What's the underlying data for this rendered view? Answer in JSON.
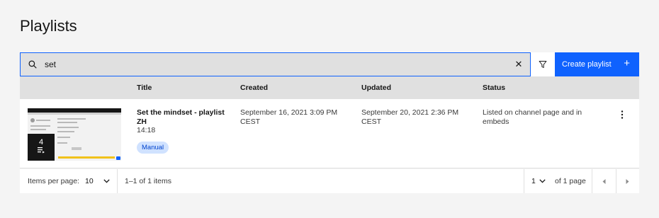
{
  "page": {
    "title": "Playlists"
  },
  "toolbar": {
    "search_value": "set",
    "clear_glyph": "✕",
    "create_label": "Create playlist",
    "create_plus": "+"
  },
  "table": {
    "headers": {
      "title": "Title",
      "created": "Created",
      "updated": "Updated",
      "status": "Status"
    },
    "rows": [
      {
        "title": "Set the mindset - playlist ZH",
        "duration": "14:18",
        "badge": "Manual",
        "item_count": "4",
        "created": "September 16, 2021 3:09 PM CEST",
        "updated": "September 20, 2021 2:36 PM CEST",
        "status": "Listed on channel page and in embeds"
      }
    ]
  },
  "pagination": {
    "items_per_page_label": "Items per page:",
    "items_per_page_value": "10",
    "range_text": "1–1 of 1 items",
    "page_value": "1",
    "of_pages_text": "of 1 page"
  },
  "colors": {
    "accent": "#0f62fe",
    "badge_bg": "#d0e2ff",
    "header_bg": "#e0e0e0",
    "page_bg": "#f4f4f4"
  }
}
